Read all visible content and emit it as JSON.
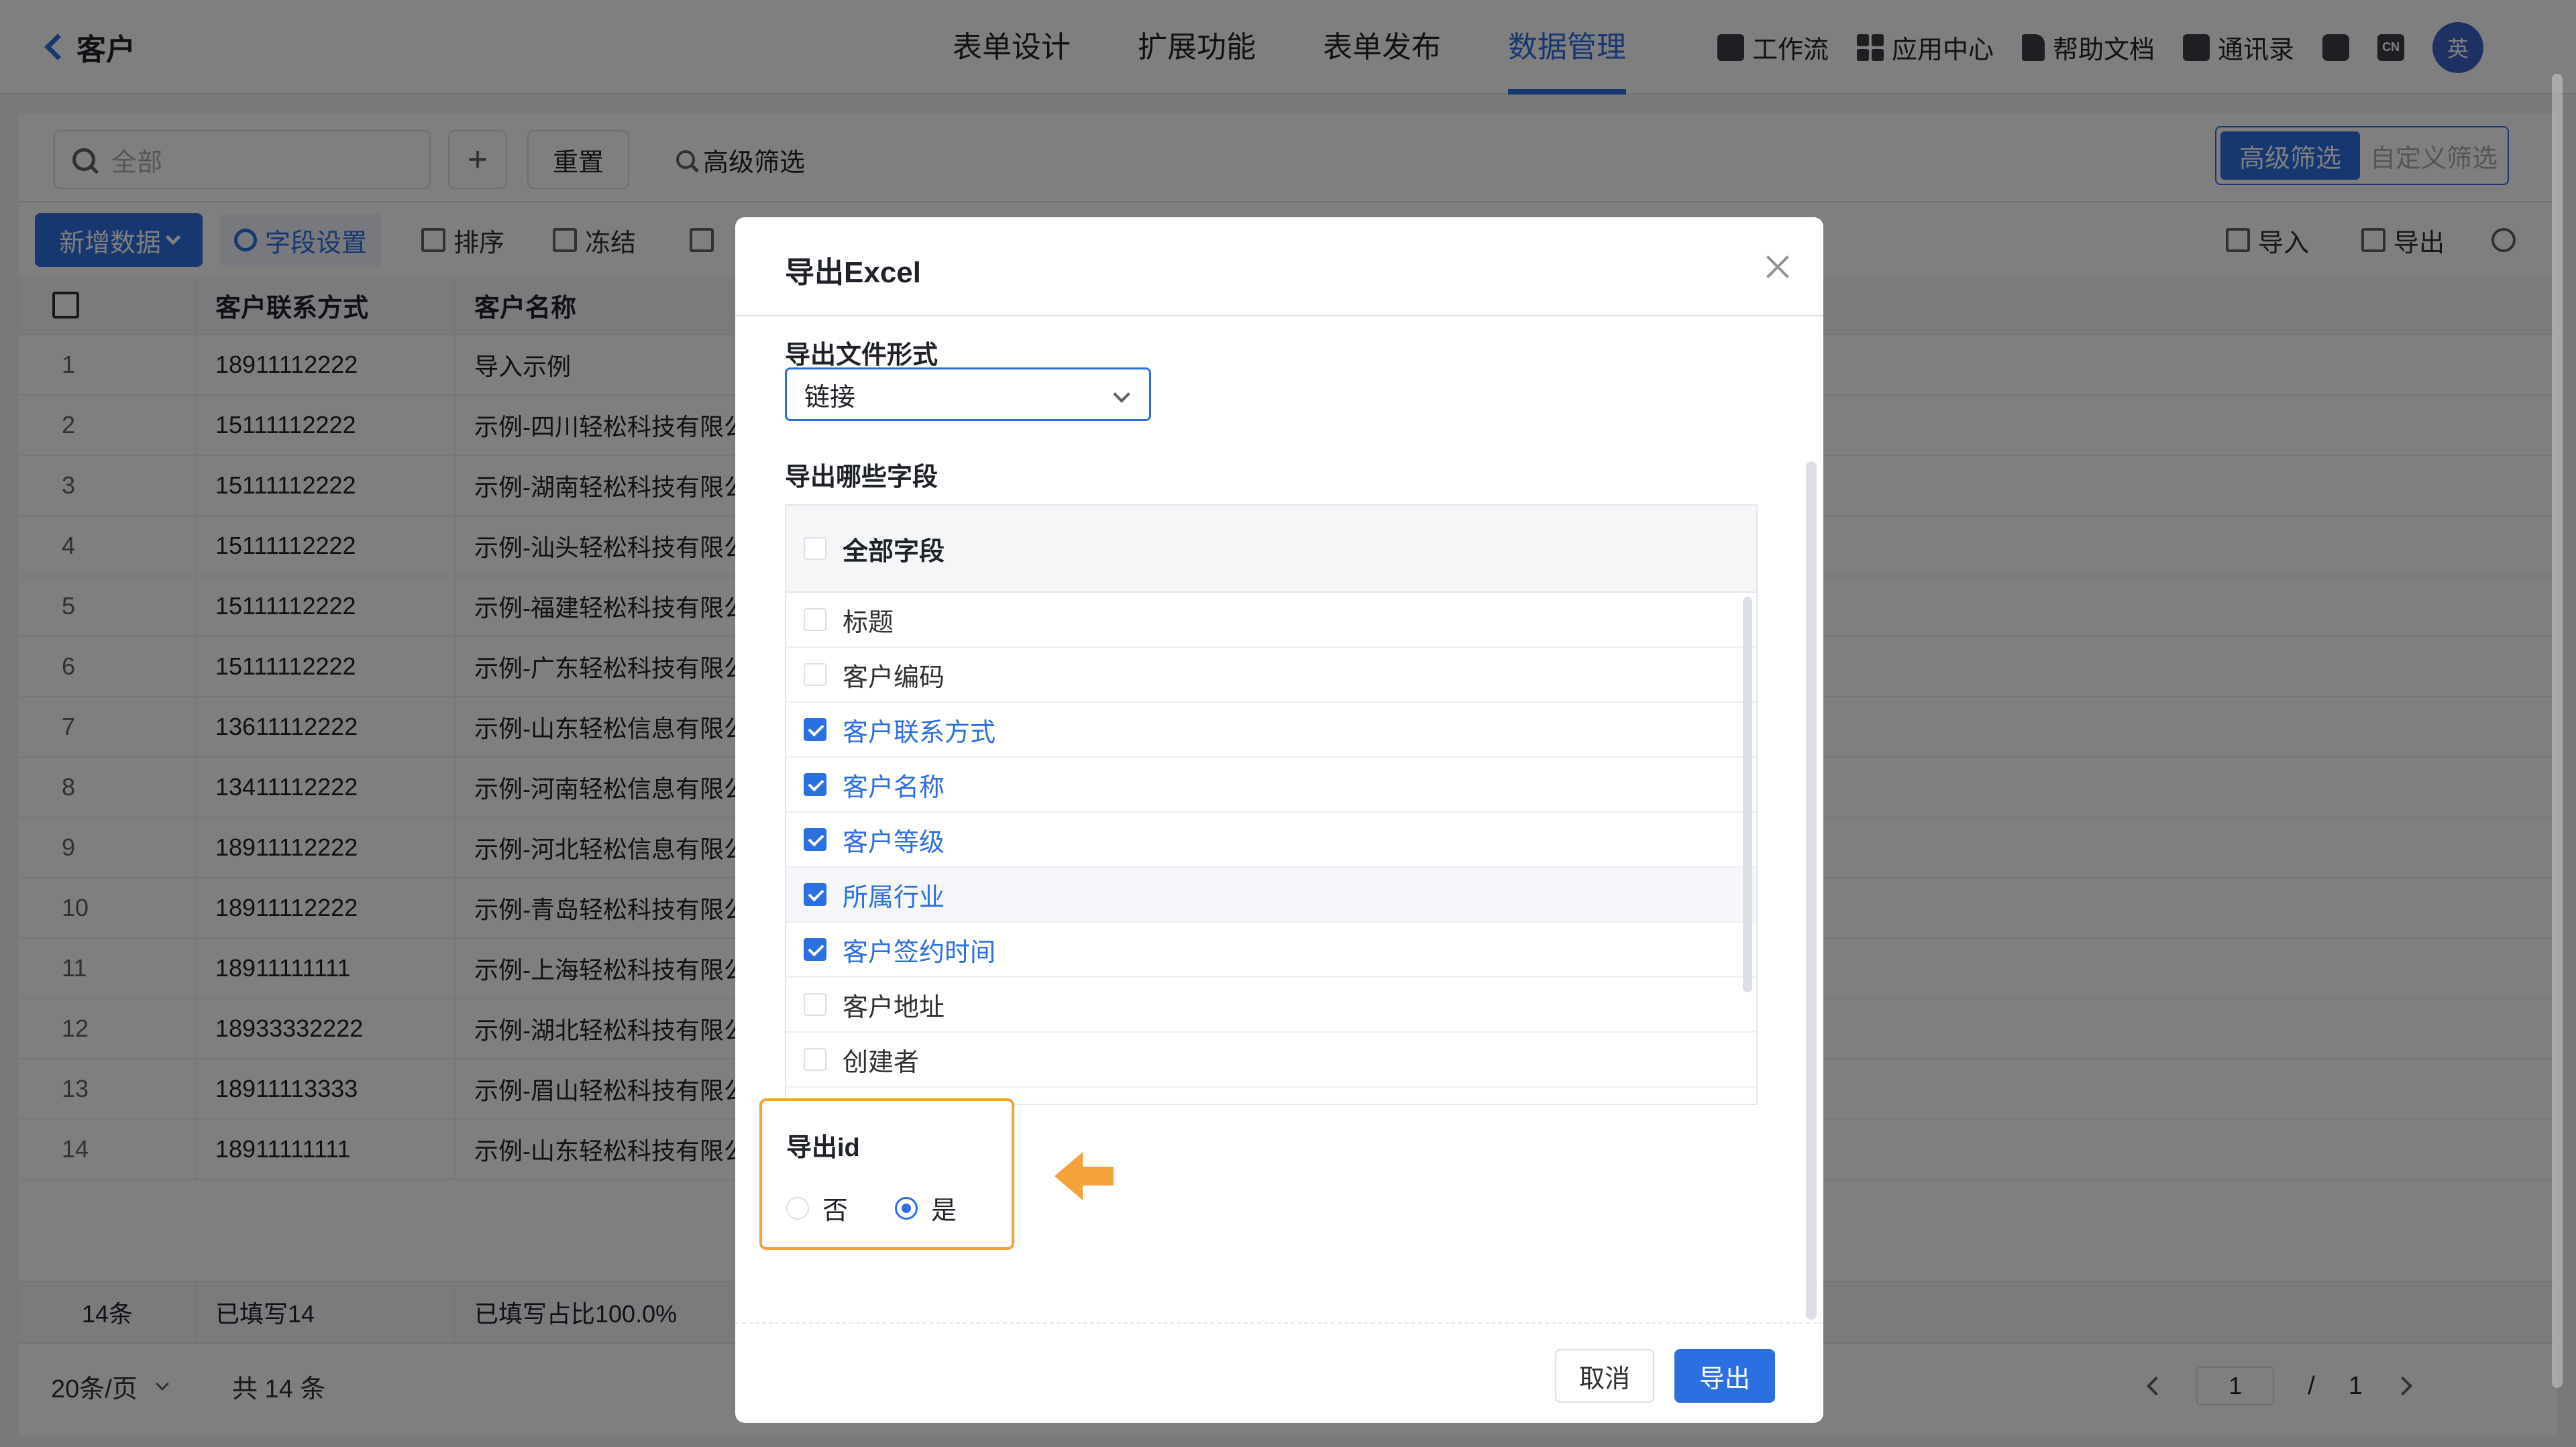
{
  "header": {
    "title": "客户",
    "tabs": [
      {
        "label": "表单设计"
      },
      {
        "label": "扩展功能"
      },
      {
        "label": "表单发布"
      },
      {
        "label": "数据管理"
      }
    ],
    "tools": [
      {
        "label": "工作流",
        "icon": "workflow-icon"
      },
      {
        "label": "应用中心",
        "icon": "app-grid-icon"
      },
      {
        "label": "帮助文档",
        "icon": "document-icon"
      },
      {
        "label": "通讯录",
        "icon": "contacts-icon"
      }
    ],
    "lang_badge": "CN",
    "avatar_text": "英"
  },
  "filter": {
    "search_placeholder": "全部",
    "add_symbol": "+",
    "reset_label": "重置",
    "advanced_label": "高级筛选",
    "seg_advanced": "高级筛选",
    "seg_custom": "自定义筛选"
  },
  "actions": {
    "new_data": "新增数据",
    "field_settings": "字段设置",
    "sort": "排序",
    "freeze": "冻结",
    "import": "导入",
    "export": "导出"
  },
  "table": {
    "headers": {
      "contact": "客户联系方式",
      "name": "客户名称"
    },
    "rows": [
      {
        "no": "1",
        "contact": "18911112222",
        "name": "导入示例"
      },
      {
        "no": "2",
        "contact": "15111112222",
        "name": "示例-四川轻松科技有限公"
      },
      {
        "no": "3",
        "contact": "15111112222",
        "name": "示例-湖南轻松科技有限公"
      },
      {
        "no": "4",
        "contact": "15111112222",
        "name": "示例-汕头轻松科技有限公"
      },
      {
        "no": "5",
        "contact": "15111112222",
        "name": "示例-福建轻松科技有限公"
      },
      {
        "no": "6",
        "contact": "15111112222",
        "name": "示例-广东轻松科技有限公"
      },
      {
        "no": "7",
        "contact": "13611112222",
        "name": "示例-山东轻松信息有限公"
      },
      {
        "no": "8",
        "contact": "13411112222",
        "name": "示例-河南轻松信息有限公"
      },
      {
        "no": "9",
        "contact": "18911112222",
        "name": "示例-河北轻松信息有限公"
      },
      {
        "no": "10",
        "contact": "18911112222",
        "name": "示例-青岛轻松科技有限公"
      },
      {
        "no": "11",
        "contact": "18911111111",
        "name": "示例-上海轻松科技有限公"
      },
      {
        "no": "12",
        "contact": "18933332222",
        "name": "示例-湖北轻松科技有限公"
      },
      {
        "no": "13",
        "contact": "18911113333",
        "name": "示例-眉山轻松科技有限公"
      },
      {
        "no": "14",
        "contact": "18911111111",
        "name": "示例-山东轻松科技有限公"
      }
    ],
    "summary": {
      "count": "14条",
      "filled": "已填写14",
      "ratio": "已填写占比100.0%"
    }
  },
  "pager": {
    "page_size": "20条/页",
    "total": "共 14 条",
    "current": "1",
    "separator": "/",
    "pages": "1"
  },
  "modal": {
    "title": "导出Excel",
    "file_format_label": "导出文件形式",
    "file_format_value": "链接",
    "fields_label": "导出哪些字段",
    "all_fields": "全部字段",
    "fields": [
      {
        "label": "标题",
        "checked": false
      },
      {
        "label": "客户编码",
        "checked": false
      },
      {
        "label": "客户联系方式",
        "checked": true
      },
      {
        "label": "客户名称",
        "checked": true
      },
      {
        "label": "客户等级",
        "checked": true
      },
      {
        "label": "所属行业",
        "checked": true
      },
      {
        "label": "客户签约时间",
        "checked": true
      },
      {
        "label": "客户地址",
        "checked": false
      },
      {
        "label": "创建者",
        "checked": false
      }
    ],
    "export_id_label": "导出id",
    "option_no": "否",
    "option_yes": "是",
    "export_id_selected": "是",
    "cancel_label": "取消",
    "export_label": "导出"
  },
  "colors": {
    "primary": "#2c6fe0",
    "highlight": "#f5a23a"
  }
}
